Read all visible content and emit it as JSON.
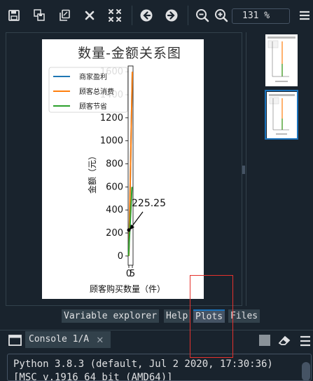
{
  "toolbar": {
    "icons": [
      "save-icon",
      "save-all-icon",
      "copy-icon",
      "close-icon",
      "close-all-icon",
      "back-icon",
      "forward-icon",
      "zoom-out-icon",
      "zoom-in-icon"
    ],
    "zoom_value": "131 %"
  },
  "figure": {
    "title": "数量-金额关系图",
    "xlabel": "顾客购买数量（件）",
    "ylabel": "金额（元）",
    "annotation": "225.25"
  },
  "chart_data": {
    "type": "line",
    "title": "数量-金额关系图",
    "xlabel": "顾客购买数量（件）",
    "ylabel": "金额（元）",
    "x_tick_labels": [
      "0",
      "5"
    ],
    "yticks": [
      0,
      200,
      400,
      600,
      800,
      1000,
      1200,
      1400,
      1600
    ],
    "ylim": [
      -80,
      1650
    ],
    "legend": "top-left",
    "series": [
      {
        "name": "商家盈利",
        "color": "#1f77b4",
        "points": [
          [
            0,
            0
          ],
          [
            5,
            1600
          ]
        ]
      },
      {
        "name": "顾客总消费",
        "color": "#ff7f0e",
        "points": [
          [
            0,
            0
          ],
          [
            5,
            1600
          ]
        ]
      },
      {
        "name": "顾客节省",
        "color": "#2ca02c",
        "points": [
          [
            0,
            0
          ],
          [
            5,
            600
          ]
        ]
      }
    ],
    "annotations": [
      {
        "text": "225.25",
        "x": 0,
        "y": 225.25
      }
    ]
  },
  "tabs": [
    {
      "label": "Variable explorer",
      "active": false
    },
    {
      "label": "Help",
      "active": false
    },
    {
      "label": "Plots",
      "active": true
    },
    {
      "label": "Files",
      "active": false
    }
  ],
  "console": {
    "tab_label": "Console 1/A",
    "lines": [
      "Python 3.8.3 (default, Jul  2 2020, 17:30:36)",
      "[MSC v.1916 64 bit (AMD64)]"
    ]
  },
  "colors": {
    "background": "#19232d",
    "border": "#32414b",
    "accent": "#1a72bb",
    "text": "#e0e1e3",
    "highlight_box": "#e5322d"
  }
}
